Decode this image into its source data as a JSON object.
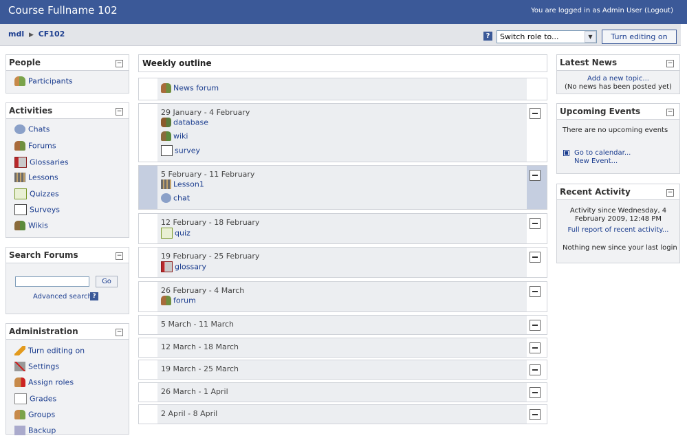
{
  "header": {
    "course_title": "Course Fullname 102",
    "login_text": "You are logged in as Admin User",
    "logout_label": "(Logout)"
  },
  "nav": {
    "breadcrumb": [
      "mdl",
      "CF102"
    ],
    "switch_role_placeholder": "Switch role to...",
    "edit_button": "Turn editing on"
  },
  "blocks": {
    "people": {
      "title": "People",
      "items": [
        {
          "label": "Participants",
          "icon": "participants-icon"
        }
      ]
    },
    "activities": {
      "title": "Activities",
      "items": [
        {
          "label": "Chats",
          "icon": "chat-icon"
        },
        {
          "label": "Forums",
          "icon": "forum-icon"
        },
        {
          "label": "Glossaries",
          "icon": "glossary-icon"
        },
        {
          "label": "Lessons",
          "icon": "lesson-icon"
        },
        {
          "label": "Quizzes",
          "icon": "quiz-icon"
        },
        {
          "label": "Surveys",
          "icon": "survey-icon"
        },
        {
          "label": "Wikis",
          "icon": "wiki-icon"
        }
      ]
    },
    "search_forums": {
      "title": "Search Forums",
      "go_label": "Go",
      "advanced_label": "Advanced search"
    },
    "administration": {
      "title": "Administration",
      "items": [
        {
          "label": "Turn editing on",
          "icon": "pencil-icon"
        },
        {
          "label": "Settings",
          "icon": "settings-icon"
        },
        {
          "label": "Assign roles",
          "icon": "roles-icon"
        },
        {
          "label": "Grades",
          "icon": "grades-icon"
        },
        {
          "label": "Groups",
          "icon": "groups-icon"
        },
        {
          "label": "Backup",
          "icon": "backup-icon"
        }
      ]
    },
    "latest_news": {
      "title": "Latest News",
      "add_link": "Add a new topic...",
      "empty_text": "(No news has been posted yet)"
    },
    "upcoming_events": {
      "title": "Upcoming Events",
      "empty_text": "There are no upcoming events",
      "calendar_link": "Go to calendar...",
      "new_event_link": "New Event..."
    },
    "recent_activity": {
      "title": "Recent Activity",
      "since_line1": "Activity since Wednesday, 4",
      "since_line2": "February 2009, 12:48 PM",
      "full_report_link": "Full report of recent activity...",
      "nothing_text": "Nothing new since your last login"
    }
  },
  "outline": {
    "title": "Weekly outline",
    "sections": [
      {
        "date": "",
        "activities": [
          {
            "label": "News forum",
            "icon": "forum-icon"
          }
        ]
      },
      {
        "date": "29 January - 4 February",
        "activities": [
          {
            "label": "database",
            "icon": "database-icon"
          },
          {
            "label": "wiki",
            "icon": "wiki-icon"
          },
          {
            "label": "survey",
            "icon": "survey-icon"
          }
        ]
      },
      {
        "date": "5 February - 11 February",
        "current": true,
        "activities": [
          {
            "label": "Lesson1",
            "icon": "lesson-icon"
          },
          {
            "label": "chat",
            "icon": "chat-icon"
          }
        ]
      },
      {
        "date": "12 February - 18 February",
        "activities": [
          {
            "label": "quiz",
            "icon": "quiz-icon"
          }
        ]
      },
      {
        "date": "19 February - 25 February",
        "activities": [
          {
            "label": "glossary",
            "icon": "glossary-icon"
          }
        ]
      },
      {
        "date": "26 February - 4 March",
        "activities": [
          {
            "label": "forum",
            "icon": "forum-icon"
          }
        ]
      },
      {
        "date": "5 March - 11 March",
        "activities": []
      },
      {
        "date": "12 March - 18 March",
        "activities": []
      },
      {
        "date": "19 March - 25 March",
        "activities": []
      },
      {
        "date": "26 March - 1 April",
        "activities": []
      },
      {
        "date": "2 April - 8 April",
        "activities": []
      }
    ]
  }
}
